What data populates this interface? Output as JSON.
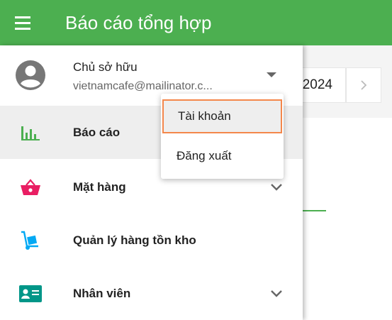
{
  "appbar": {
    "title": "Báo cáo tổng hợp",
    "menu_icon": "hamburger-icon"
  },
  "background": {
    "date_text": "2024",
    "next_icon": "chevron-right-icon"
  },
  "account": {
    "name": "Chủ sở hữu",
    "email": "vietnamcafe@mailinator.c...",
    "avatar_icon": "account-circle-icon",
    "caret_icon": "caret-down-icon"
  },
  "nav": {
    "items": [
      {
        "label": "Báo cáo",
        "icon": "bar-chart-icon",
        "active": true,
        "expandable": false
      },
      {
        "label": "Mặt hàng",
        "icon": "basket-icon",
        "active": false,
        "expandable": true
      },
      {
        "label": "Quản lý hàng tồn kho",
        "icon": "hand-truck-icon",
        "active": false,
        "expandable": false
      },
      {
        "label": "Nhân viên",
        "icon": "id-card-icon",
        "active": false,
        "expandable": true
      }
    ]
  },
  "dropdown": {
    "items": [
      {
        "label": "Tài khoản",
        "highlighted": true
      },
      {
        "label": "Đăng xuất",
        "highlighted": false
      }
    ]
  },
  "colors": {
    "primary": "#4caf50",
    "report_icon": "#4caf50",
    "basket_icon": "#e91e63",
    "inventory_icon": "#03a9f4",
    "employee_icon": "#009688",
    "highlight_border": "#f4874b"
  }
}
